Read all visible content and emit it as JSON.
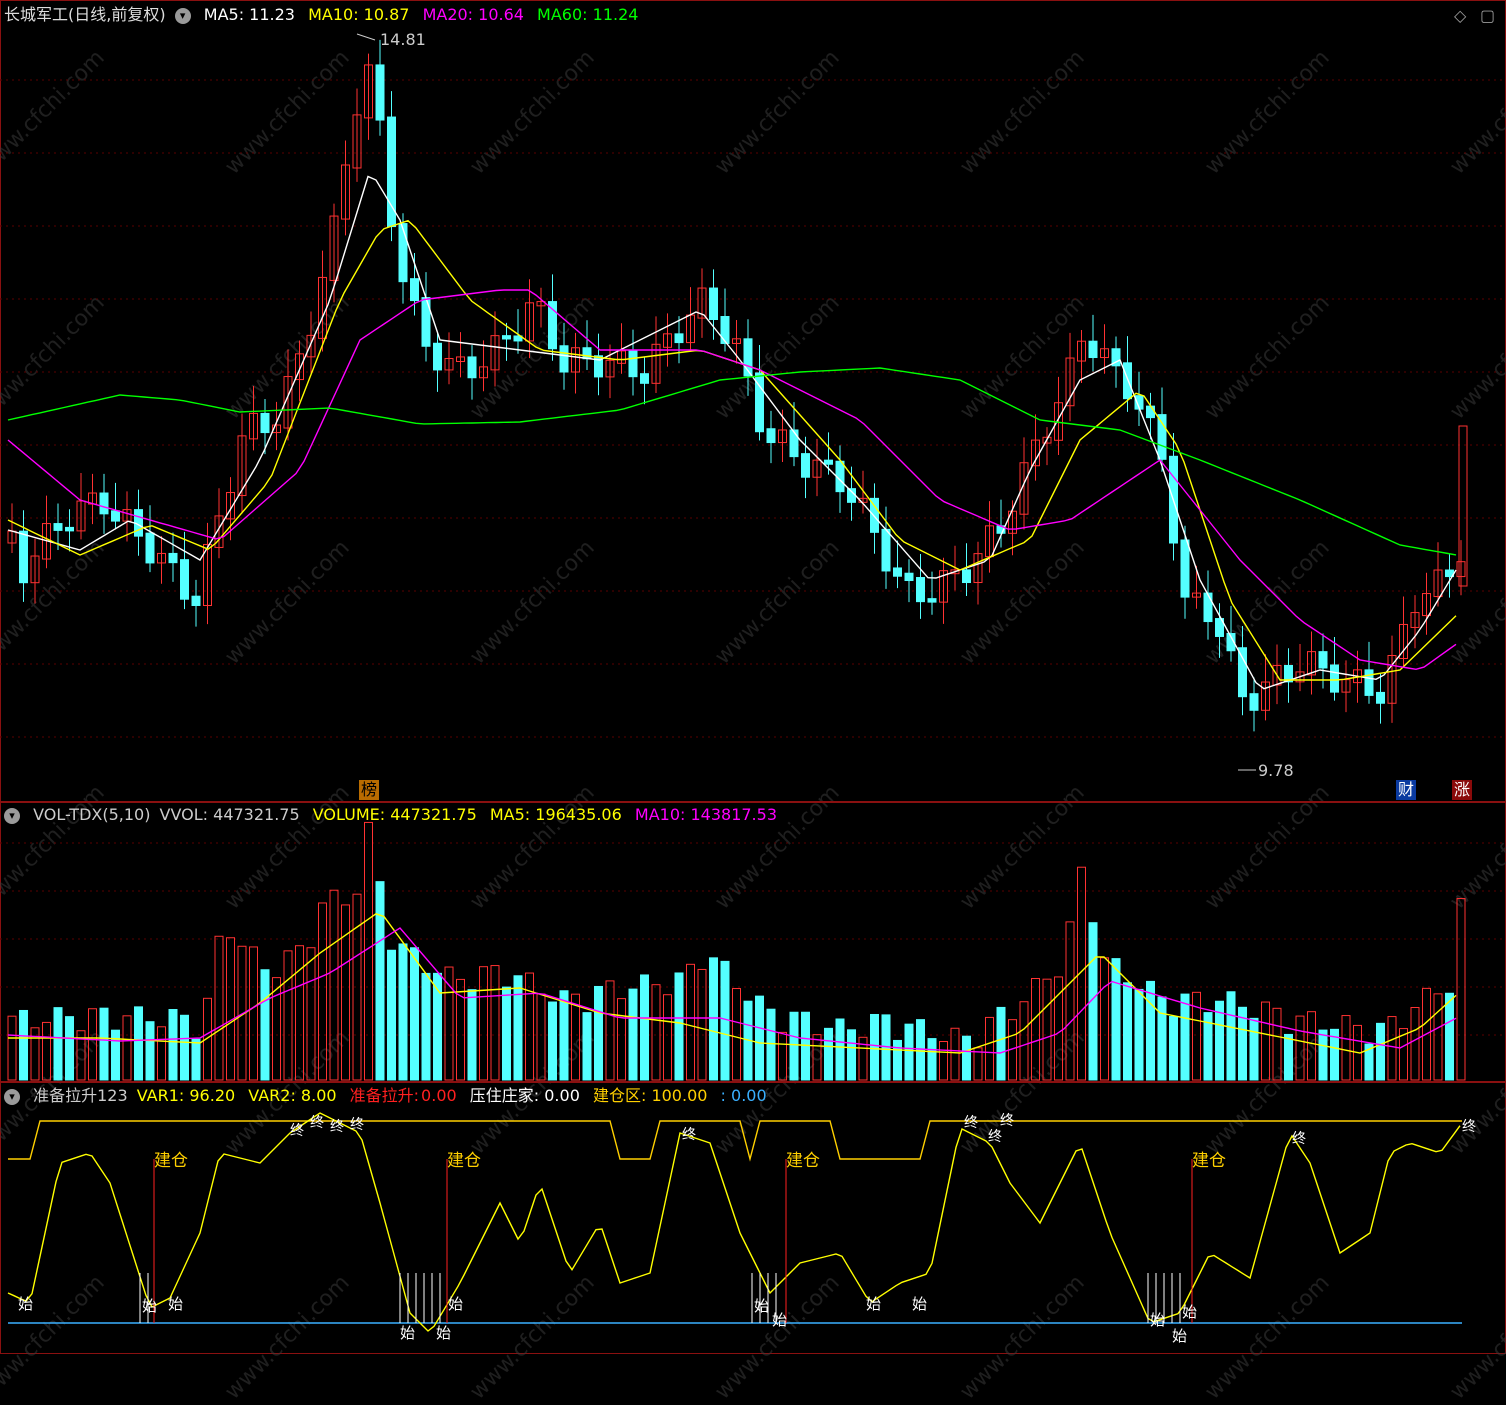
{
  "main": {
    "title": "长城军工(日线,前复权)",
    "ma5_label": "MA5: 11.23",
    "ma10_label": "MA10: 10.87",
    "ma20_label": "MA20: 10.64",
    "ma60_label": "MA60: 11.24",
    "high_label": "14.81",
    "low_label": "9.78",
    "bang_tag": "榜",
    "cai_tag": "财",
    "zhang_tag": "涨",
    "colors": {
      "up": "#ff3232",
      "down": "#54ffff",
      "ma5": "#ffffff",
      "ma10": "#ffff00",
      "ma20": "#ff00ff",
      "ma60": "#00ff00"
    }
  },
  "vol": {
    "title": "VOL-TDX(5,10)",
    "vvol_label": "VVOL: 447321.75",
    "volume_label": "VOLUME: 447321.75",
    "ma5_label": "MA5: 196435.06",
    "ma10_label": "MA10: 143817.53"
  },
  "ind": {
    "title": "准备拉升123",
    "var1_label": "VAR1: 96.20",
    "var2_label": "VAR2: 8.00",
    "zbls_label": "准备拉升:",
    "zbls_value": "0.00",
    "yzzj_label": "压住庄家: 0.00",
    "jcq_label": "建仓区: 100.00",
    "extra_label": ": 0.00",
    "jiancang": "建仓",
    "shi": "始",
    "zhong": "终"
  },
  "watermark": "www.cfchi.com"
}
